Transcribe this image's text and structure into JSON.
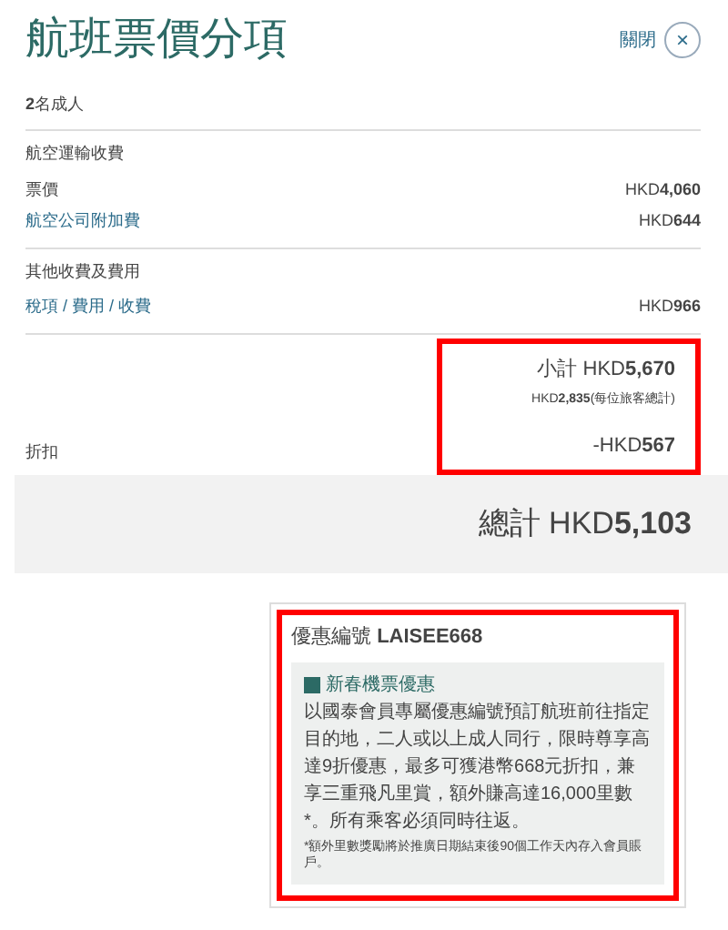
{
  "title": "航班票價分項",
  "close": {
    "label": "關閉",
    "icon": "×"
  },
  "passengers": "**2**名成人",
  "sections": [
    {
      "heading": "航空運輸收費",
      "items": [
        {
          "label": "票價",
          "link": false,
          "amount": "HKD**4,060**"
        },
        {
          "label": "航空公司附加費",
          "link": true,
          "amount": "HKD**644**"
        }
      ]
    },
    {
      "heading": "其他收費及費用",
      "items": [
        {
          "label": "稅項 / 費用 / 收費",
          "link": true,
          "amount": "HKD**966**"
        }
      ]
    }
  ],
  "subtotal": {
    "highlighted": true,
    "total": "小計 HKD**5,670**",
    "per_passenger": "HKD**2,835**(每位旅客總計)",
    "discount_label": "折扣",
    "discount": "-HKD**567**"
  },
  "grand_total": "總計 HKD**5,103**",
  "promo": {
    "highlighted": true,
    "code": "優惠編號 **LAISEE668**",
    "offer_title": "新春機票優惠",
    "description": "以國泰會員專屬優惠編號預訂航班前往指定目的地，二人或以上成人同行，限時尊享高達9折優惠，最多可獲港幣668元折扣，兼享三重飛凡里賞，額外賺高達16,000里數*。所有乘客必須同時往返。",
    "footnote": "*額外里數獎勵將於推廣日期結束後90個工作天內存入會員賬戶。"
  }
}
